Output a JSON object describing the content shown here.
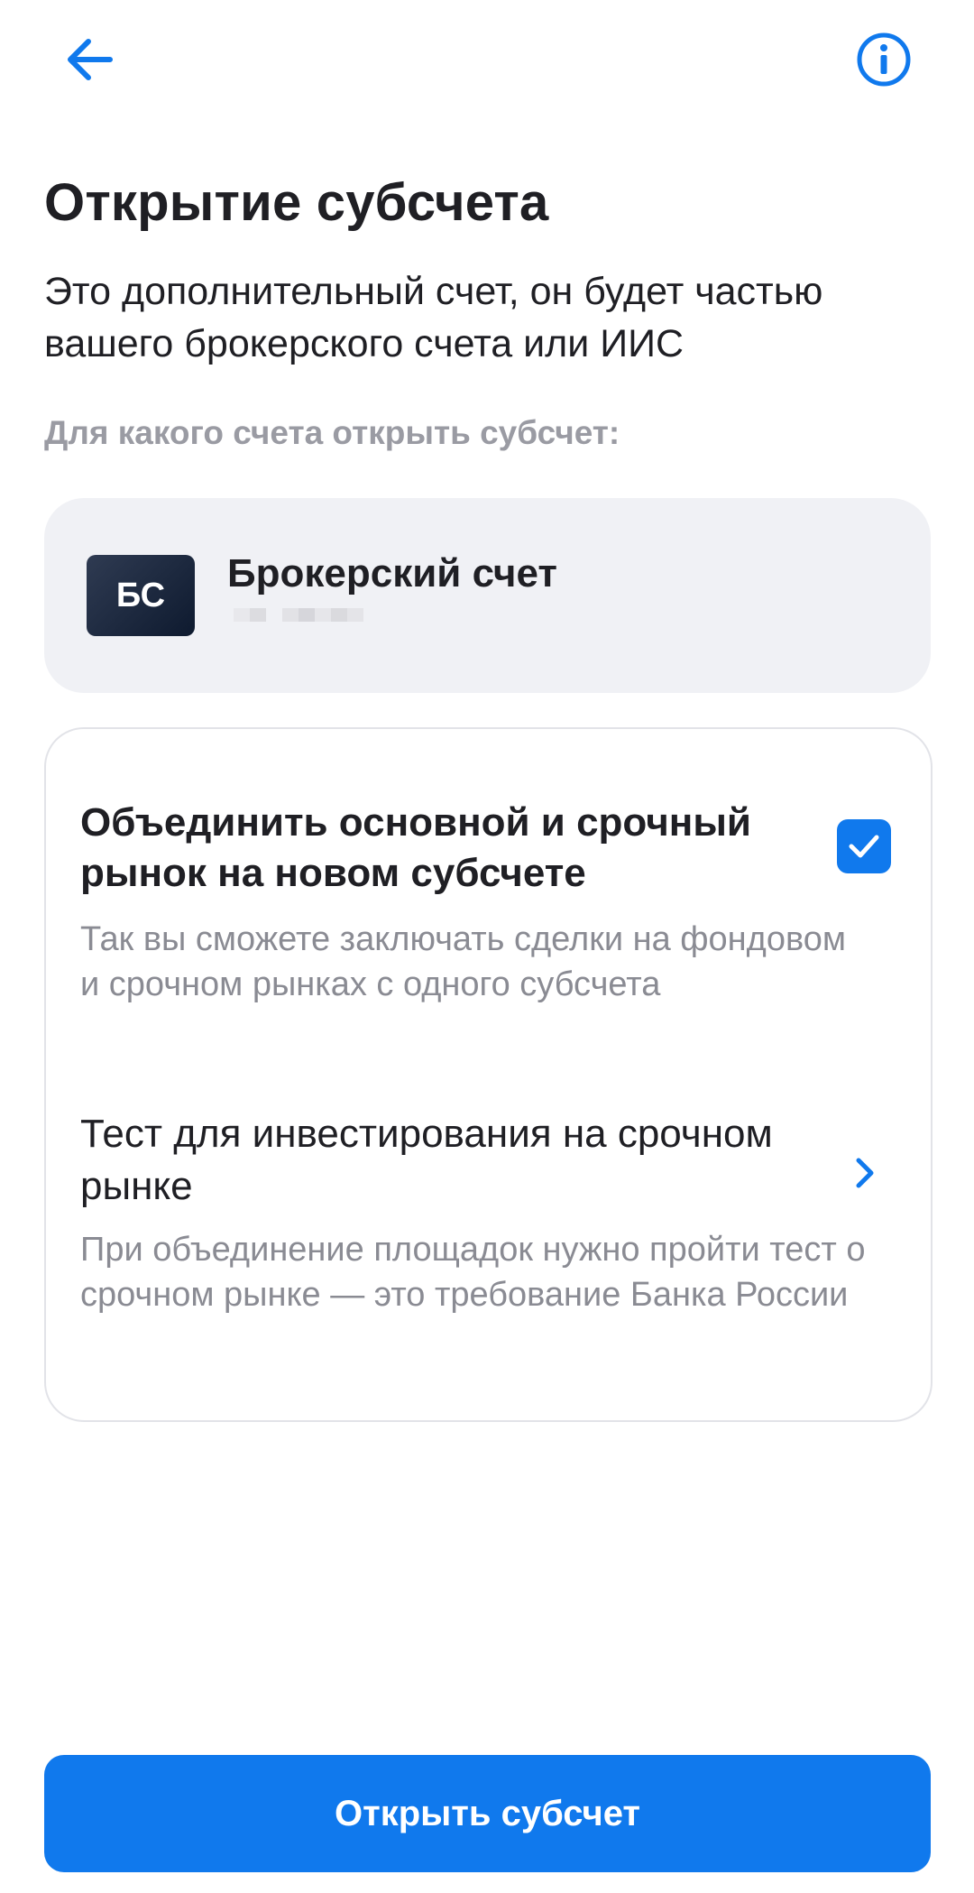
{
  "header": {
    "back_icon": "arrow-left-icon",
    "info_icon": "info-circle-icon",
    "accent_color": "#1079ed"
  },
  "page": {
    "title": "Открытие субсчета",
    "subtitle": "Это дополнительный счет, он будет частью вашего брокерского счета или ИИС",
    "section_label": "Для какого счета открыть субсчет:"
  },
  "account": {
    "badge": "БС",
    "name": "Брокерский счет",
    "number_masked": true
  },
  "options": {
    "merge": {
      "title": "Объединить основной и срочный рынок на новом субсчете",
      "description": "Так вы сможете заключать сделки на фондовом и срочном рынках с одного субсчета",
      "checked": true
    },
    "test": {
      "title": "Тест для инвестирования на срочном рынке",
      "description": "При объединение площадок нужно пройти тест о срочном рынке — это требование Банка России",
      "icon": "chevron-right-icon"
    }
  },
  "footer": {
    "primary_button": "Открыть субсчет"
  }
}
